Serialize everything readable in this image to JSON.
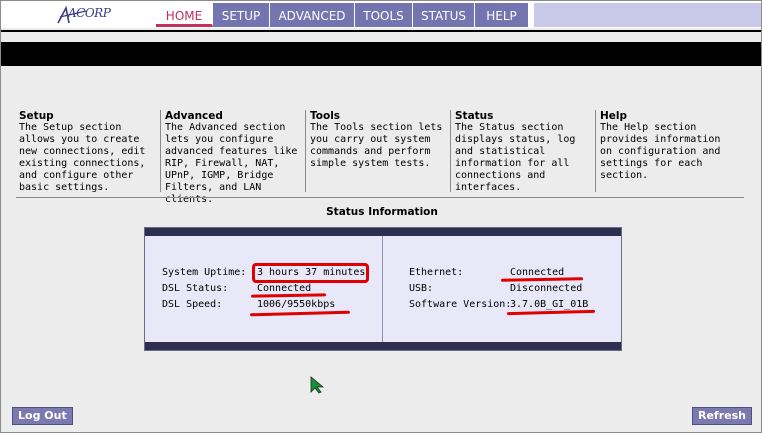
{
  "brand": {
    "logo_text": "ACORP"
  },
  "nav": {
    "tabs": [
      {
        "label": "HOME",
        "active": true
      },
      {
        "label": "SETUP",
        "active": false
      },
      {
        "label": "ADVANCED",
        "active": false
      },
      {
        "label": "TOOLS",
        "active": false
      },
      {
        "label": "STATUS",
        "active": false
      },
      {
        "label": "HELP",
        "active": false
      }
    ]
  },
  "sections": [
    {
      "title": "Setup",
      "text": "The Setup section allows you to create new connections, edit existing connections, and configure other basic settings."
    },
    {
      "title": "Advanced",
      "text": "The Advanced section lets you configure advanced features like RIP, Firewall, NAT, UPnP, IGMP, Bridge Filters, and LAN clients."
    },
    {
      "title": "Tools",
      "text": "The Tools section lets you carry out system commands and perform simple system tests."
    },
    {
      "title": "Status",
      "text": "The Status section displays status, log and statistical information for all connections and interfaces."
    },
    {
      "title": "Help",
      "text": "The Help section provides information on configuration and settings for each section."
    }
  ],
  "status": {
    "title": "Status Information",
    "left": [
      {
        "label": "System Uptime:",
        "value": "3 hours 37 minutes"
      },
      {
        "label": "DSL Status:",
        "value": "Connected"
      },
      {
        "label": "DSL Speed:",
        "value": "1006/9550kbps"
      }
    ],
    "right": [
      {
        "label": "Ethernet:",
        "value": "Connected"
      },
      {
        "label": "USB:",
        "value": "Disconnected"
      },
      {
        "label": "Software Version:",
        "value": "3.7.0B_GI_01B"
      }
    ]
  },
  "buttons": {
    "logout": "Log Out",
    "refresh": "Refresh"
  },
  "colors": {
    "nav": "#7474b0",
    "active_tab": "#c4305a",
    "annotation": "#e00000",
    "panel": "#e8e8f8"
  }
}
